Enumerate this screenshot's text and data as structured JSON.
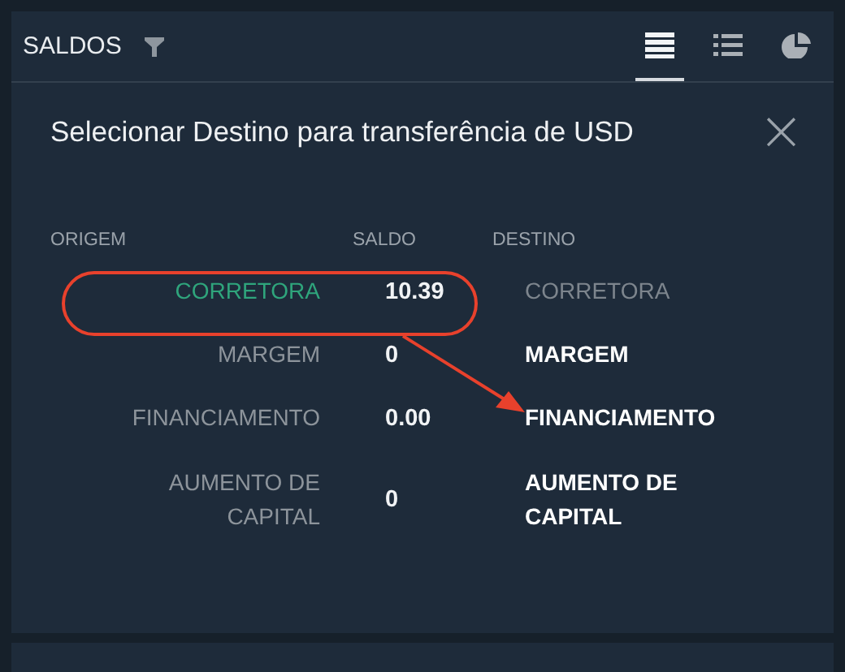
{
  "panel": {
    "title": "SALDOS",
    "views": [
      {
        "kind": "table",
        "selected": true
      },
      {
        "kind": "list",
        "selected": false
      },
      {
        "kind": "pie",
        "selected": false
      }
    ]
  },
  "dialog": {
    "title": "Selecionar Destino para transferência de USD",
    "close": "×"
  },
  "columns": [
    "ORIGEM",
    "SALDO",
    "DESTINO"
  ],
  "rows": [
    {
      "origin": "CORRETORA",
      "balance": "10.39",
      "destination": "CORRETORA",
      "selected": true,
      "disabled": true
    },
    {
      "origin": "MARGEM",
      "balance": "0",
      "destination": "MARGEM",
      "selected": false,
      "disabled": false
    },
    {
      "origin": "FINANCIAMENTO",
      "balance": "0.00",
      "destination": "FINANCIAMENTO",
      "selected": false,
      "disabled": false
    },
    {
      "origin": "AUMENTO DE CAPITAL",
      "balance": "0",
      "destination": "AUMENTO DE CAPITAL",
      "selected": false,
      "disabled": false
    }
  ]
}
